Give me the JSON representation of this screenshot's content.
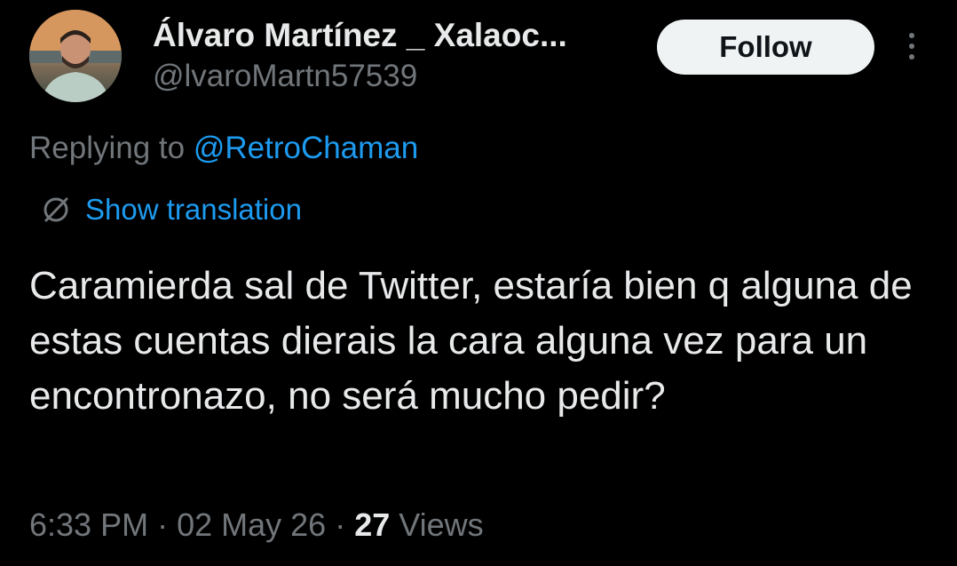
{
  "author": {
    "display_name": "Álvaro Martínez _ Xalaoc...",
    "handle": "@lvaroMartn57539",
    "avatar_icon": "user-avatar"
  },
  "actions": {
    "follow_label": "Follow",
    "more_icon": "more-vertical-icon"
  },
  "reply": {
    "prefix": "Replying to ",
    "mention": "@RetroChaman"
  },
  "translation": {
    "icon": "globe-icon",
    "label": "Show translation"
  },
  "tweet": {
    "text": "Caramierda sal de Twitter, estaría bien q alguna de estas cuentas dierais la cara alguna vez para un encontronazo, no será mucho pedir?"
  },
  "meta": {
    "time": "6:33 PM",
    "date": "02 May 26",
    "views_count": "27",
    "views_label": "Views",
    "separator": " · "
  },
  "colors": {
    "background": "#000000",
    "text_primary": "#e7e9ea",
    "text_secondary": "#71767b",
    "accent_blue": "#1d9bf0",
    "follow_bg": "#eff3f4"
  }
}
